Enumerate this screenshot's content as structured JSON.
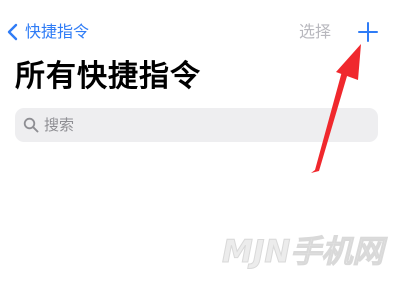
{
  "nav": {
    "back_label": "快捷指令",
    "select_label": "选择"
  },
  "page": {
    "title": "所有快捷指令"
  },
  "search": {
    "placeholder": "搜索"
  },
  "watermark": {
    "text": "MJN手机网"
  },
  "colors": {
    "accent": "#2f7cf6",
    "disabled": "#b8b8be",
    "search_bg": "#eeeef0",
    "annotation_arrow": "#f0282d"
  },
  "icons": {
    "back": "chevron-left-icon",
    "add": "plus-icon",
    "search": "magnifier-icon"
  }
}
